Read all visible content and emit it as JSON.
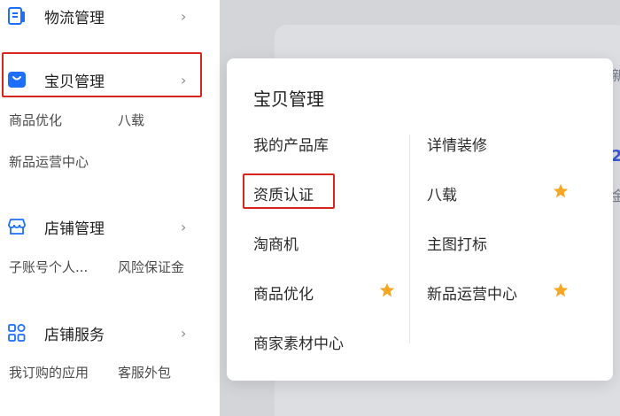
{
  "sidebar": {
    "sections": [
      {
        "title": "物流管理",
        "subitems": []
      },
      {
        "title": "宝贝管理",
        "subitems": [
          "商品优化",
          "八载",
          "新品运营中心"
        ]
      },
      {
        "title": "店铺管理",
        "subitems": [
          "子账号个人...",
          "风险保证金"
        ]
      },
      {
        "title": "店铺服务",
        "subitems": [
          "我订购的应用",
          "客服外包"
        ]
      }
    ],
    "chevron": "›"
  },
  "background": {
    "edge_text_1": "新",
    "edge_text_2": "2",
    "edge_text_3": "金"
  },
  "popup": {
    "title": "宝贝管理",
    "left_items": [
      "我的产品库",
      "资质认证",
      "淘商机",
      "商品优化",
      "商家素材中心"
    ],
    "right_items": [
      "详情装修",
      "八载",
      "主图打标",
      "新品运营中心"
    ]
  },
  "icons": {
    "logistics": "logistics-doc-icon",
    "goods": "goods-bag-icon",
    "store": "store-icon",
    "service": "grid-apps-icon",
    "star": "star-icon"
  },
  "colors": {
    "accent_blue": "#1f6fff",
    "highlight_red": "#d9261c",
    "star_orange": "#f5a623"
  }
}
